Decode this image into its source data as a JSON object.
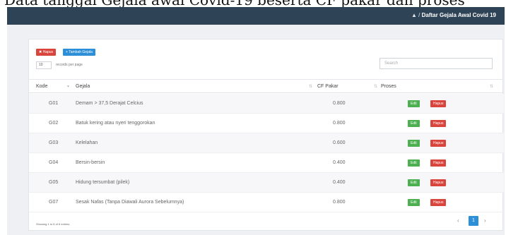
{
  "caption_text": "Data tanggal Gejala awal Covid-19 beserta CF pakar dan proses",
  "header": {
    "home_glyph": "▲",
    "separator": "/",
    "breadcrumb_title": "Daftar Gejala Awal Covid 19"
  },
  "toolbar": {
    "delete_label": "Hapus",
    "add_label": "Tambah Gejala"
  },
  "length": {
    "value": "10",
    "label": "records per page"
  },
  "search": {
    "placeholder": "Search"
  },
  "table": {
    "columns": [
      "Kode",
      "Gejala",
      "CF Pakar",
      "Proses"
    ],
    "rows": [
      {
        "kode": "G01",
        "gejala": "Demam > 37,5 Derajat Celcius",
        "cf": "0.800"
      },
      {
        "kode": "G02",
        "gejala": "Batuk kering atau nyeri tenggorokan",
        "cf": "0.800"
      },
      {
        "kode": "G03",
        "gejala": "Kelelahan",
        "cf": "0.600"
      },
      {
        "kode": "G04",
        "gejala": "Bersin-bersin",
        "cf": "0.400"
      },
      {
        "kode": "G05",
        "gejala": "Hidung tersumbat (pilek)",
        "cf": "0.400"
      },
      {
        "kode": "G07",
        "gejala": "Sesak Nafas (Tanpa Diawali Aurora Sebelumnya)",
        "cf": "0.800"
      }
    ],
    "edit_label": "Edit",
    "delete_label": "Hapus"
  },
  "footer": {
    "info": "Showing 1 to 6 of 6 entries",
    "prev": "‹",
    "page": "1",
    "next": "›"
  },
  "colors": {
    "topbar": "#2f4356",
    "danger": "#d9453c",
    "primary": "#2d8fd8",
    "success": "#4caf50"
  }
}
